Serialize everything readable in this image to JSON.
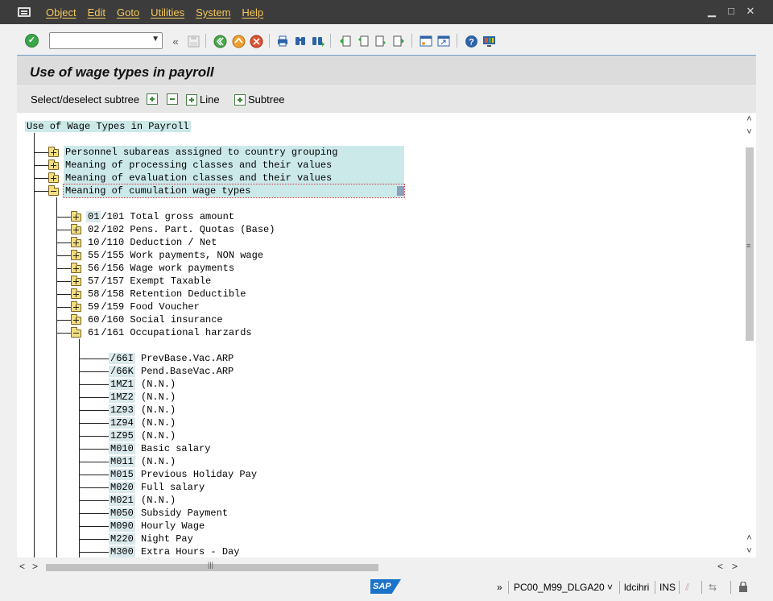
{
  "menu": {
    "items": [
      "Object",
      "Edit",
      "Goto",
      "Utilities",
      "System",
      "Help"
    ],
    "window_controls": [
      "minimize-icon",
      "maximize-icon",
      "close-icon"
    ]
  },
  "toolbar": {
    "command_field_value": "",
    "icons": [
      "enter-icon",
      "command-field",
      "collapse-icon",
      "save-icon",
      "back-icon",
      "exit-icon",
      "cancel-icon",
      "print-icon",
      "find-icon",
      "find-next-icon",
      "first-page-icon",
      "previous-page-icon",
      "next-page-icon",
      "last-page-icon",
      "create-session-icon",
      "shortcut-icon",
      "help-icon",
      "customize-layout-icon"
    ]
  },
  "title": "Use of wage types in payroll",
  "app_toolbar": {
    "select_label": "Select/deselect subtree",
    "line_label": "Line",
    "subtree_label": "Subtree"
  },
  "tree": {
    "root": "Use of Wage Types in Payroll",
    "level1": [
      {
        "label": "Personnel subareas assigned to country grouping",
        "expanded": false
      },
      {
        "label": "Meaning of processing classes and their values",
        "expanded": false
      },
      {
        "label": "Meaning of evaluation classes and their values",
        "expanded": false
      },
      {
        "label": "Meaning of cumulation wage types",
        "expanded": true
      }
    ],
    "level2": [
      {
        "code": "01",
        "label": "/101 Total gross amount",
        "expanded": false
      },
      {
        "code": "02",
        "label": "/102 Pens. Part. Quotas (Base)",
        "expanded": false
      },
      {
        "code": "10",
        "label": "/110 Deduction / Net",
        "expanded": false
      },
      {
        "code": "55",
        "label": "/155 Work payments, NON wage",
        "expanded": false
      },
      {
        "code": "56",
        "label": "/156 Wage work payments",
        "expanded": false
      },
      {
        "code": "57",
        "label": "/157 Exempt Taxable",
        "expanded": false
      },
      {
        "code": "58",
        "label": "/158 Retention Deductible",
        "expanded": false
      },
      {
        "code": "59",
        "label": "/159 Food Voucher",
        "expanded": false
      },
      {
        "code": "60",
        "label": "/160 Social insurance",
        "expanded": false
      },
      {
        "code": "61",
        "label": "/161 Occupational harzards",
        "expanded": true
      }
    ],
    "level3": [
      {
        "key": "/66I",
        "label": "PrevBase.Vac.ARP"
      },
      {
        "key": "/66K",
        "label": "Pend.BaseVac.ARP"
      },
      {
        "key": "1MZ1",
        "label": "(N.N.)"
      },
      {
        "key": "1MZ2",
        "label": "(N.N.)"
      },
      {
        "key": "1Z93",
        "label": "(N.N.)"
      },
      {
        "key": "1Z94",
        "label": "(N.N.)"
      },
      {
        "key": "1Z95",
        "label": "(N.N.)"
      },
      {
        "key": "M010",
        "label": "Basic salary"
      },
      {
        "key": "M011",
        "label": "(N.N.)"
      },
      {
        "key": "M015",
        "label": "Previous Holiday Pay"
      },
      {
        "key": "M020",
        "label": "Full salary"
      },
      {
        "key": "M021",
        "label": "(N.N.)"
      },
      {
        "key": "M050",
        "label": "Subsidy Payment"
      },
      {
        "key": "M090",
        "label": "Hourly Wage"
      },
      {
        "key": "M220",
        "label": "Night Pay"
      },
      {
        "key": "M300",
        "label": "Extra Hours - Day"
      }
    ]
  },
  "status": {
    "expand_glyph": "»",
    "system": "PC00_M99_DLGA20",
    "user": "ldcihri",
    "mode": "INS"
  },
  "colors": {
    "menubar_bg": "#3c3c3c",
    "menu_text": "#f5c85a",
    "highlight": "#cce9ea",
    "sap_blue": "#1a73c8"
  }
}
